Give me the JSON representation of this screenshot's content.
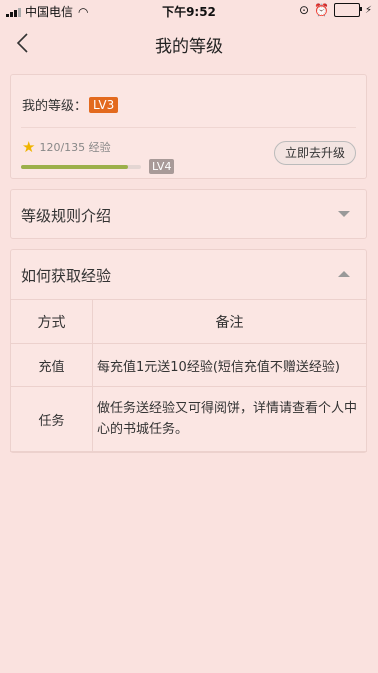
{
  "status_bar": {
    "carrier": "中国电信",
    "time": "下午9:52"
  },
  "nav": {
    "title": "我的等级"
  },
  "level_card": {
    "level_label": "我的等级：",
    "current_level": "LV3",
    "exp_text": "120/135 经验",
    "progress_percent": 88.9,
    "next_level": "LV4",
    "upgrade_button": "立即去升级"
  },
  "rules_section": {
    "title": "等级规则介绍"
  },
  "exp_section": {
    "title": "如何获取经验",
    "headers": [
      "方式",
      "备注"
    ],
    "rows": [
      {
        "method": "充值",
        "note": "每充值1元送10经验(短信充值不赠送经验)"
      },
      {
        "method": "任务",
        "note": "做任务送经验又可得阅饼，详情请查看个人中心的书城任务。"
      }
    ]
  },
  "colors": {
    "background": "#fae2df",
    "badge": "#e36a1e",
    "progress": "#9cb04a"
  }
}
